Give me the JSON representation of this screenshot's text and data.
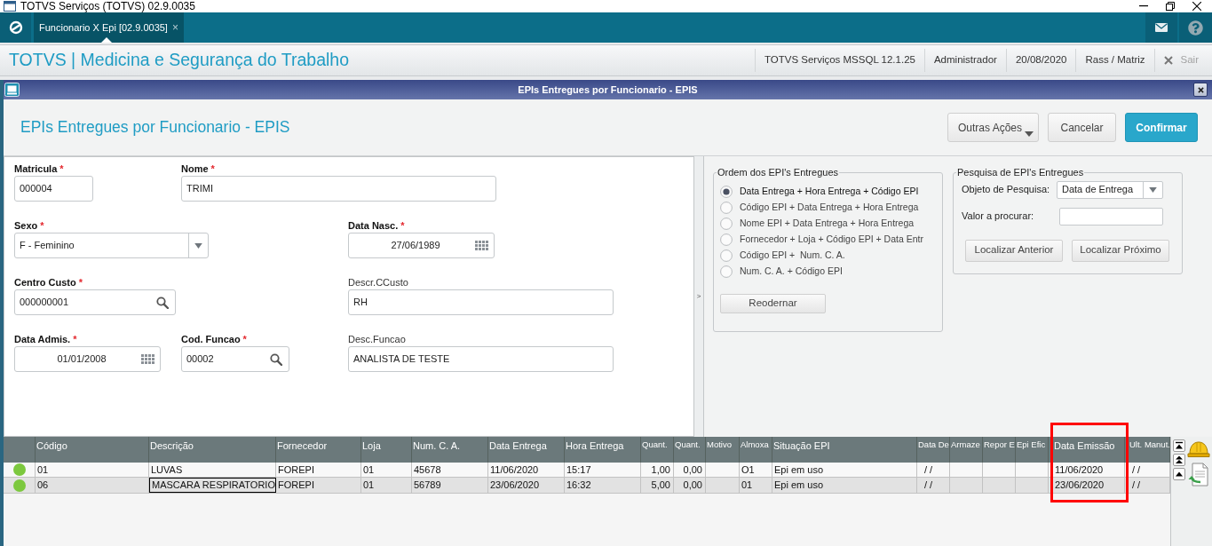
{
  "window": {
    "title": "TOTVS Serviços (TOTVS) 02.9.0035"
  },
  "nav": {
    "tabs": [
      {
        "label": "Funcionario X Epi [02.9.0035]",
        "close": "×",
        "selected": true
      }
    ]
  },
  "header": {
    "title": "TOTVS | Medicina e Segurança do Trabalho",
    "info": [
      "TOTVS Serviços MSSQL 12.1.25",
      "Administrador",
      "20/08/2020",
      "Rass / Matriz"
    ],
    "exit": {
      "label": "Sair",
      "disabled": true
    }
  },
  "dialog": {
    "title": "EPIs Entregues por Funcionario - EPIS",
    "heading": "EPIs Entregues por Funcionario - EPIS",
    "actions": [
      {
        "label": "Outras Ações",
        "kind": "menu"
      },
      {
        "label": "Cancelar",
        "kind": "secondary"
      },
      {
        "label": "Confirmar",
        "kind": "primary"
      }
    ]
  },
  "form": {
    "fields": [
      {
        "label": "Matricula",
        "required": true,
        "mark": "*",
        "kind": "text",
        "value": "000004"
      },
      {
        "label": "Nome",
        "required": true,
        "mark": "*",
        "kind": "text",
        "value": "TRIMI"
      },
      {
        "label": "Sexo",
        "required": true,
        "mark": "*",
        "kind": "select",
        "value": "F - Feminino"
      },
      {
        "label": "Data Nasc.",
        "required": true,
        "mark": "*",
        "kind": "date",
        "value": "27/06/1989"
      },
      {
        "label": "Centro Custo",
        "required": true,
        "mark": "*",
        "kind": "lookup",
        "value": "000000001"
      },
      {
        "label": "Descr.CCusto",
        "required": false,
        "kind": "text",
        "value": "RH"
      },
      {
        "label": "Data Admis.",
        "required": true,
        "mark": "*",
        "kind": "date",
        "value": "01/01/2008"
      },
      {
        "label": "Cod. Funcao",
        "required": true,
        "mark": "*",
        "kind": "lookup",
        "value": "00002"
      },
      {
        "label": "Desc.Funcao",
        "required": false,
        "kind": "text",
        "value": "ANALISTA DE TESTE"
      }
    ]
  },
  "splitter": {
    "label": ">"
  },
  "order_group": {
    "title": "Ordem dos EPI's Entregues",
    "options": [
      {
        "label": "Data Entrega + Hora Entrega + Código EPI",
        "selected": true
      },
      {
        "label": "Código EPI + Data Entrega + Hora Entrega",
        "selected": false
      },
      {
        "label": "Nome EPI + Data Entrega + Hora Entrega",
        "selected": false
      },
      {
        "label": "Fornecedor + Loja + Código EPI + Data Entr",
        "selected": false
      },
      {
        "label": "Código EPI +  Num. C. A.",
        "selected": false
      },
      {
        "label": "Num. C. A. + Código EPI",
        "selected": false
      }
    ],
    "button": "Reodernar"
  },
  "search_group": {
    "title": "Pesquisa de EPI's Entregues",
    "object_label": "Objeto de Pesquisa:",
    "object_value": "Data de Entrega",
    "value_label": "Valor a procurar:",
    "buttons": [
      "Localizar Anterior",
      "Localizar Próximo"
    ]
  },
  "grid": {
    "columns": [
      {
        "label": "Código",
        "focused": false,
        "highlighted": false
      },
      {
        "label": "Descrição",
        "focused": true,
        "highlighted": false
      },
      {
        "label": "Fornecedor",
        "focused": false,
        "highlighted": false
      },
      {
        "label": "Loja",
        "focused": false,
        "highlighted": false
      },
      {
        "label": "Num. C. A.",
        "focused": false,
        "highlighted": false
      },
      {
        "label": "Data Entrega",
        "focused": false,
        "highlighted": false
      },
      {
        "label": "Hora Entrega",
        "focused": false,
        "highlighted": false
      },
      {
        "label": "Quant.",
        "focused": false,
        "highlighted": false
      },
      {
        "label": "Quant.",
        "focused": false,
        "highlighted": false
      },
      {
        "label": "Motivo",
        "focused": false,
        "highlighted": false
      },
      {
        "label": "Almoxa",
        "focused": false,
        "highlighted": false
      },
      {
        "label": "Situação EPI",
        "focused": false,
        "highlighted": false
      },
      {
        "label": "Data De",
        "focused": false,
        "highlighted": false
      },
      {
        "label": "Armaze",
        "focused": false,
        "highlighted": false
      },
      {
        "label": "Repor E",
        "focused": false,
        "highlighted": false
      },
      {
        "label": "Epi Efic",
        "focused": false,
        "highlighted": false
      },
      {
        "label": "Data Emissão",
        "focused": false,
        "highlighted": true
      },
      {
        "label": "Ult. Manut.",
        "focused": false,
        "highlighted": false
      }
    ],
    "rows": [
      {
        "selected": false,
        "color": "#7cc83e",
        "cells": [
          "01",
          "LUVAS",
          "FOREPI",
          "01",
          "45678",
          "11/06/2020",
          "15:17",
          "1,00",
          "0,00",
          null,
          "O1",
          "Epi em uso",
          "/ /",
          null,
          null,
          null,
          "11/06/2020",
          "/ /"
        ]
      },
      {
        "selected": true,
        "color": "#7cc83e",
        "cells": [
          "06",
          "MASCARA RESPIRATORIO",
          "FOREPI",
          "01",
          "56789",
          "23/06/2020",
          "16:32",
          "5,00",
          "0,00",
          null,
          "01",
          "Epi em uso",
          "/ /",
          null,
          null,
          null,
          "23/06/2020",
          "/ /"
        ]
      }
    ]
  }
}
